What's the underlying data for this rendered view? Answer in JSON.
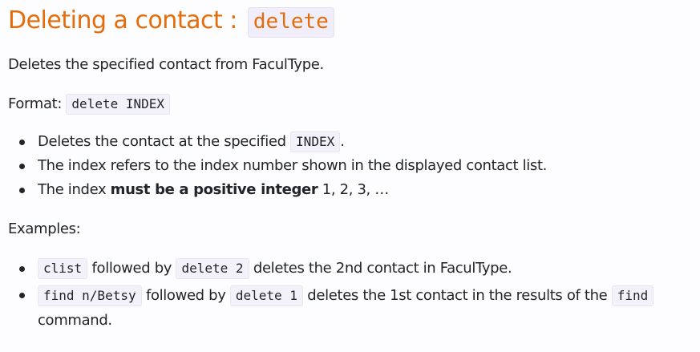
{
  "heading": {
    "text": "Deleting a contact : ",
    "code": "delete"
  },
  "description": "Deletes the specified contact from FaculType.",
  "format": {
    "label": "Format: ",
    "code": "delete INDEX"
  },
  "notes": [
    {
      "before": "Deletes the contact at the specified ",
      "code": "INDEX",
      "after": "."
    },
    {
      "text": "The index refers to the index number shown in the displayed contact list."
    },
    {
      "before": "The index ",
      "bold": "must be a positive integer",
      "after": " 1, 2, 3, …"
    }
  ],
  "examples_label": "Examples:",
  "examples": [
    {
      "code1": "clist",
      "mid": " followed by ",
      "code2": "delete 2",
      "after": " deletes the 2nd contact in FaculType."
    },
    {
      "code1": "find n/Betsy",
      "mid": " followed by ",
      "code2": "delete 1",
      "after": " deletes the 1st contact in the results of the ",
      "code3": "find",
      "tail": " command."
    }
  ]
}
